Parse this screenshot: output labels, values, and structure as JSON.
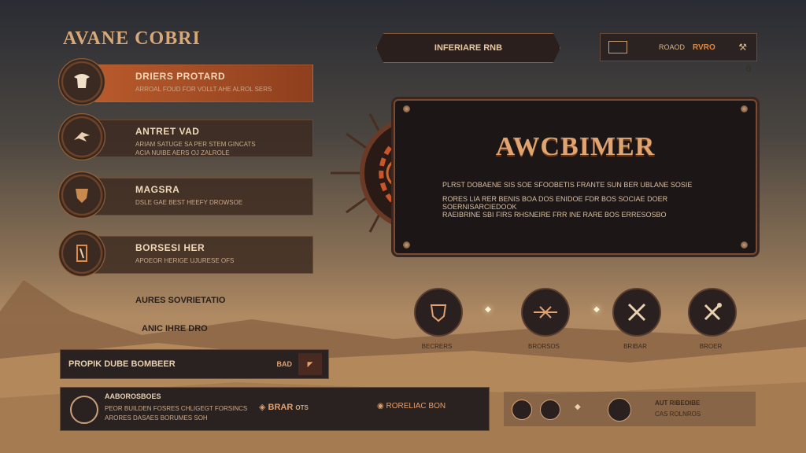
{
  "title": "AVANE COBRI",
  "menu": [
    {
      "label": "DRIERS PROTARD",
      "sub": "ARROAL FOUD FOR VOLLT AHE ALROL SERS",
      "active": true,
      "icon": "horned-helmet-icon"
    },
    {
      "label": "ANTRET VAD",
      "sub": "ARIAM SATUGE SA PER STEM GINCATS",
      "sub2": "ACIA NUIBE AERS OJ ZALROLE",
      "active": false,
      "icon": "bird-emblem-icon"
    },
    {
      "label": "MAGSRA",
      "sub": "DSLE GAE BEST HEEFY DROWSOE",
      "active": false,
      "icon": "shield-crest-icon"
    },
    {
      "label": "BORSESI HER",
      "sub": "APOEOR HERIGE UJURESE OFS",
      "active": false,
      "icon": "blade-emblem-icon"
    }
  ],
  "side_links": [
    "AURES SOVRIETATIO",
    "ANIC IHRE DRO"
  ],
  "banner": "INFERIARE RNB",
  "top_right": {
    "a": "ROAOD",
    "b": "RVRO",
    "badge": "0"
  },
  "panel": {
    "heading": "AWCBIMER",
    "line1": "PLRST DOBAENE SIS SOE SFOOBETIS FRANTE SUN BER UBLANE SOSIE",
    "line2": "RORES LIA RER BENIS BOA DOS ENIDOE FDR BOS SOCIAE DOER SOERNISARCIEDOOK",
    "line3": "RAEIBRINE SBI FIRS RHSNEIRE FRR INE RARE BOS ERRESOSBO"
  },
  "emblems": [
    {
      "caption": "BECRERS",
      "icon": "crested-shield-icon"
    },
    {
      "caption": "BRORSOS",
      "icon": "winged-blade-icon"
    },
    {
      "caption": "BRIBAR",
      "icon": "crossed-swords-icon"
    },
    {
      "caption": "BROER",
      "icon": "crossed-axes-icon"
    }
  ],
  "row1": {
    "label": "PROPIK DUBE BOMBEER",
    "right": "BAD"
  },
  "row2": {
    "title": "AABOROSBOES",
    "sub": "PEOR BUILDEN FOSRES CHLIGEGT FORSINCS",
    "sub2": "ARORES DASAES BORUMES SOH",
    "mid": "BRAR",
    "mid_small": "OTS",
    "right": "RORELIAC BON"
  },
  "row3": {
    "text": "AUT RIBEOIBE",
    "text2": "CAS ROLNROS"
  }
}
